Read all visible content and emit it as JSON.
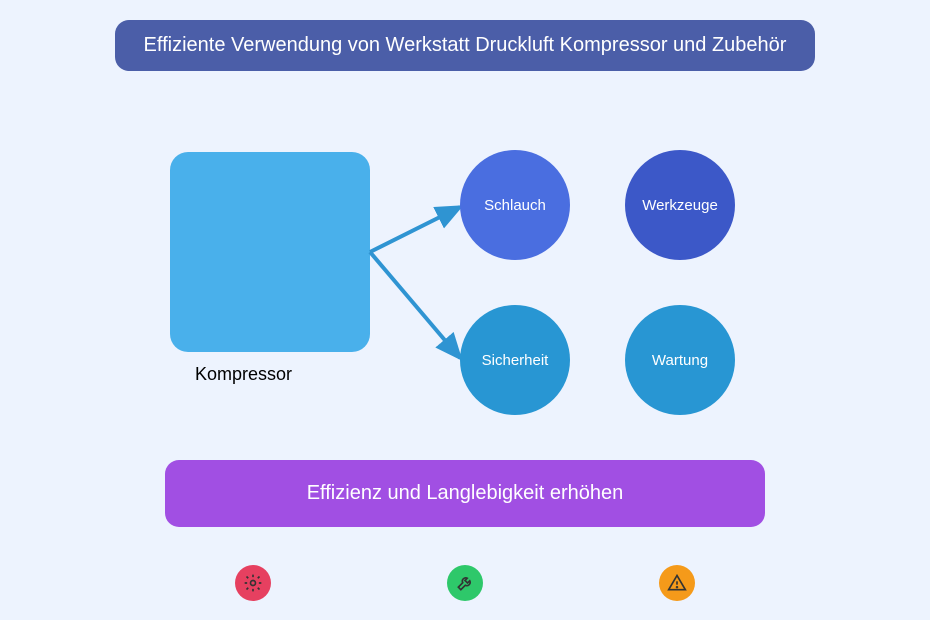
{
  "title": "Effiziente Verwendung von Werkstatt Druckluft Kompressor und Zubehör",
  "compressor": {
    "label": "Kompressor"
  },
  "nodes": {
    "hose": "Schlauch",
    "tools": "Werkzeuge",
    "safety": "Sicherheit",
    "maintenance": "Wartung"
  },
  "footer": "Effizienz und Langlebigkeit erhöhen",
  "icons": {
    "gear": "gear-icon",
    "wrench": "wrench-icon",
    "warning": "warning-icon"
  },
  "colors": {
    "bg": "#edf3fe",
    "title_bg": "#4b5ea8",
    "compressor": "#49b0eb",
    "node_blue1": "#4a6ee0",
    "node_blue2": "#3c58c8",
    "node_teal": "#2896d3",
    "footer": "#a14fe3",
    "arrow": "#2f94d2",
    "icon_red": "#e64060",
    "icon_green": "#2ec86a",
    "icon_orange": "#f59a1a"
  }
}
